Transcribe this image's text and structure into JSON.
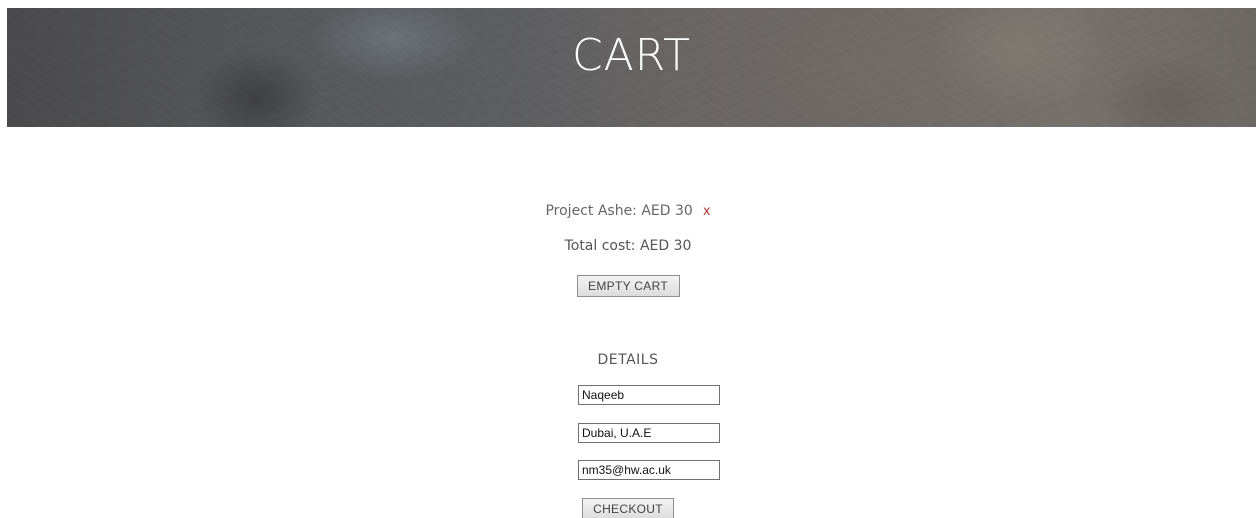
{
  "header": {
    "title": "CART"
  },
  "cart": {
    "items": [
      {
        "name": "Project Ashe: AED 30",
        "remove_label": "x"
      }
    ],
    "total": "Total cost: AED 30",
    "empty_button": "EMPTY CART"
  },
  "details": {
    "title": "DETAILS",
    "name_value": "Naqeeb",
    "address_value": "Dubai, U.A.E",
    "email_value": "nm35@hw.ac.uk",
    "checkout_button": "CHECKOUT"
  },
  "colors": {
    "remove_x": "#b03a3a",
    "hero_text": "#ffffff",
    "body_text": "#555555"
  }
}
